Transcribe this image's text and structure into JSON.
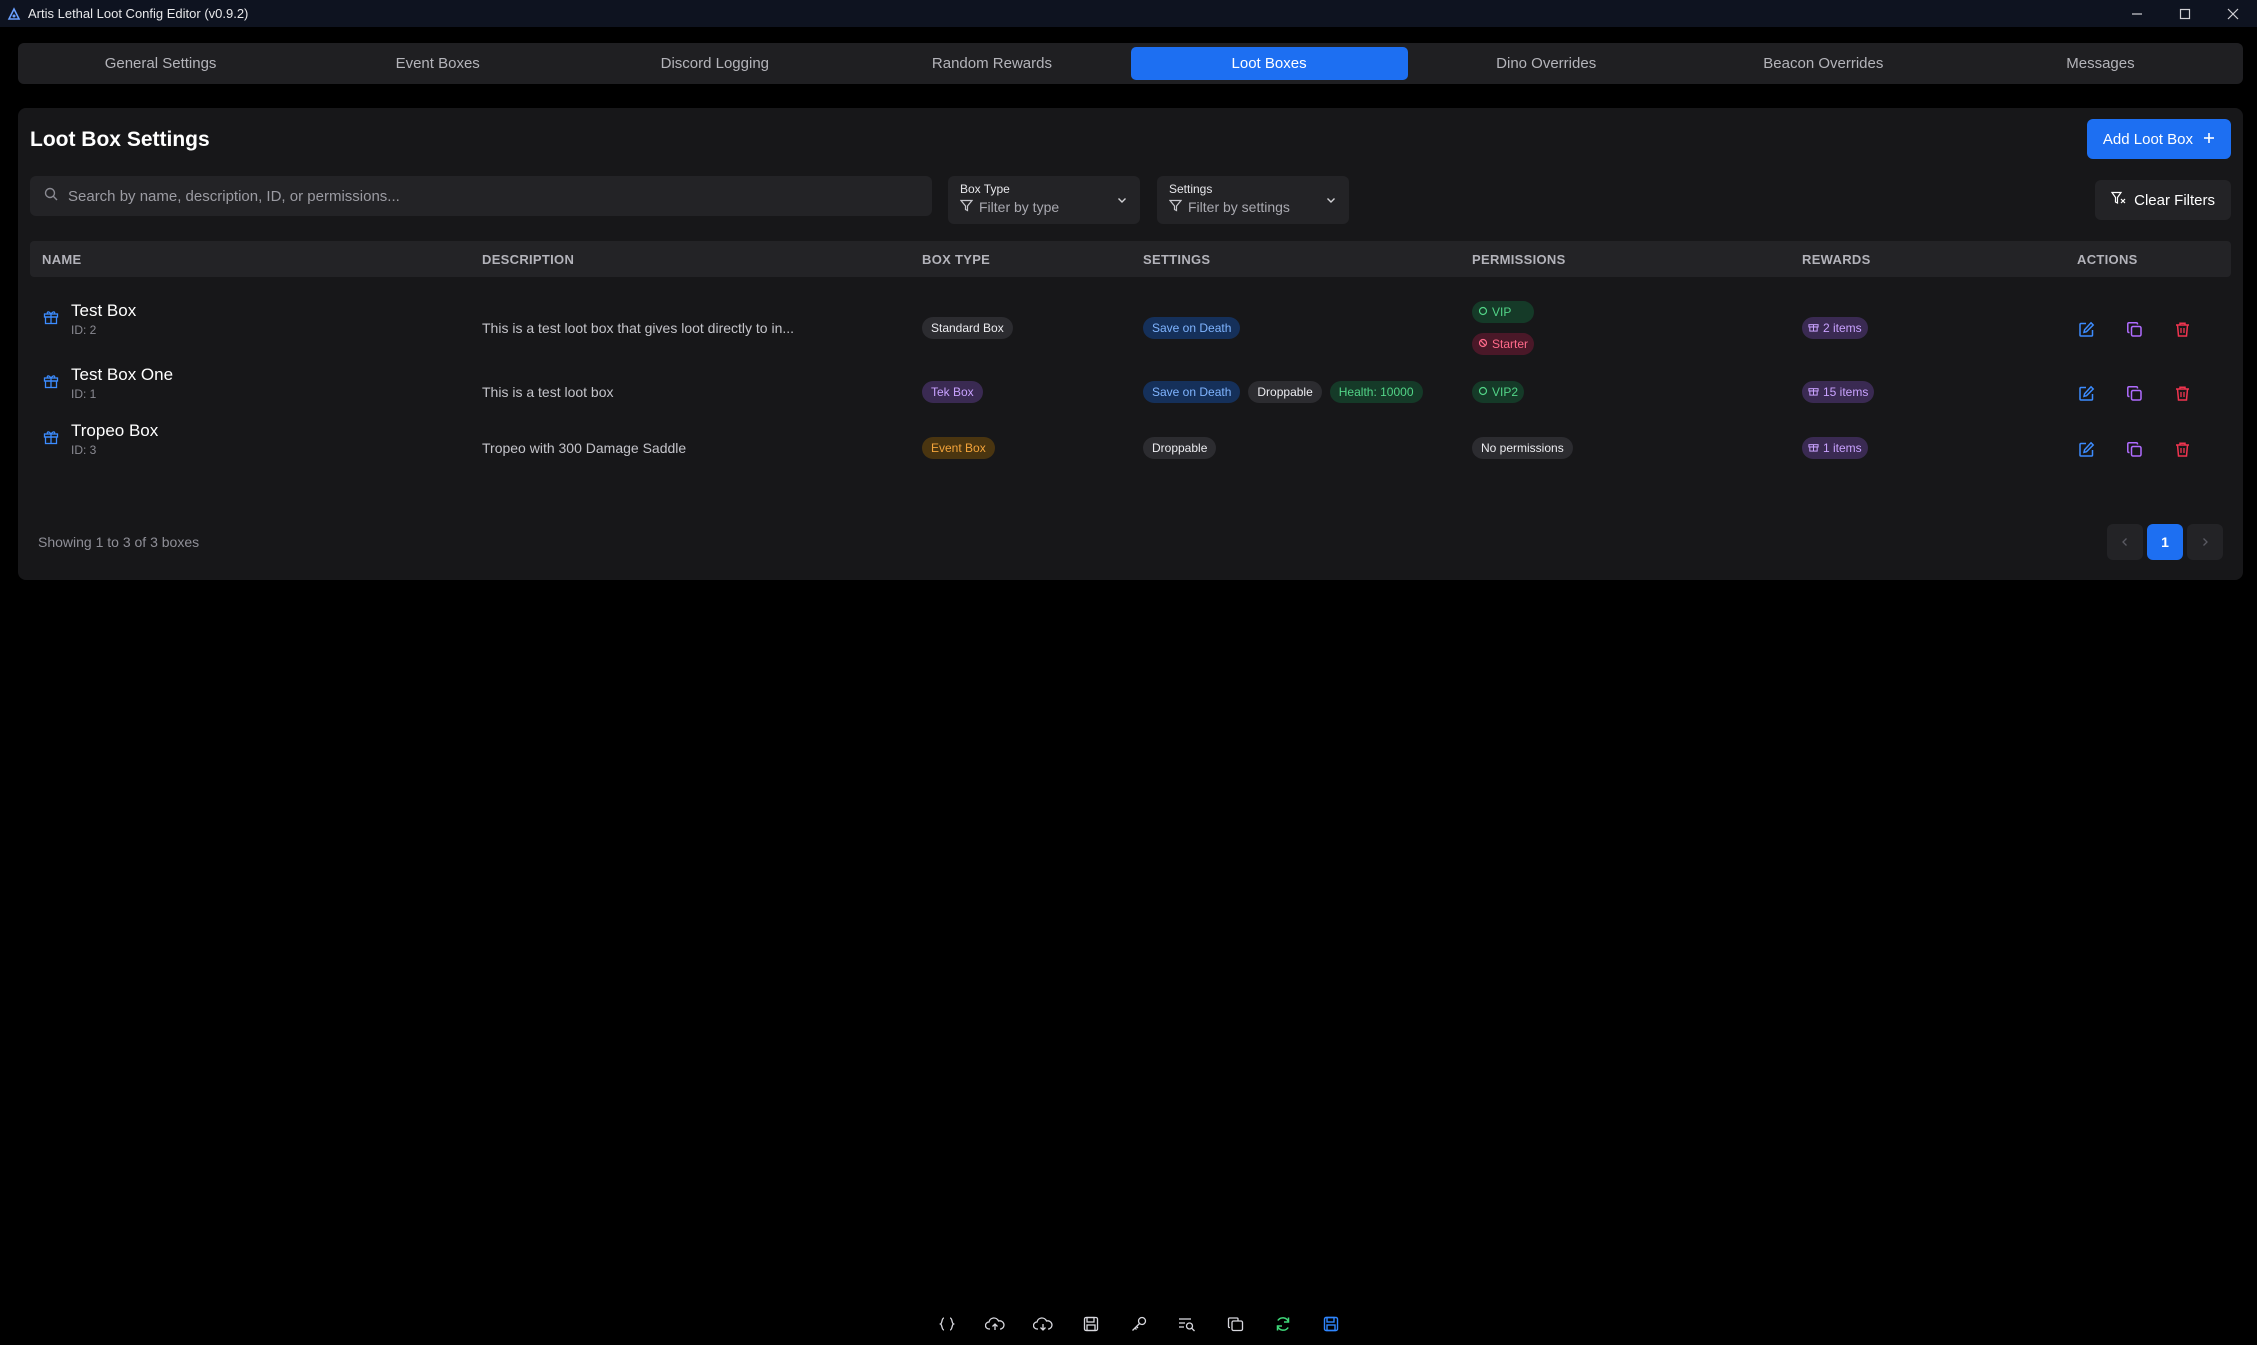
{
  "window": {
    "title": "Artis Lethal Loot Config Editor (v0.9.2)"
  },
  "tabs": [
    {
      "label": "General Settings"
    },
    {
      "label": "Event Boxes"
    },
    {
      "label": "Discord Logging"
    },
    {
      "label": "Random Rewards"
    },
    {
      "label": "Loot Boxes",
      "active": true
    },
    {
      "label": "Dino Overrides"
    },
    {
      "label": "Beacon Overrides"
    },
    {
      "label": "Messages"
    }
  ],
  "panel": {
    "title": "Loot Box Settings",
    "add_button": "Add Loot Box",
    "search_placeholder": "Search by name, description, ID, or permissions...",
    "box_type_filter": {
      "label": "Box Type",
      "value": "Filter by type"
    },
    "settings_filter": {
      "label": "Settings",
      "value": "Filter by settings"
    },
    "clear_filters": "Clear Filters"
  },
  "table": {
    "headers": {
      "name": "NAME",
      "description": "DESCRIPTION",
      "box_type": "BOX TYPE",
      "settings": "SETTINGS",
      "permissions": "PERMISSIONS",
      "rewards": "REWARDS",
      "actions": "ACTIONS"
    },
    "rows": [
      {
        "name": "Test Box",
        "id": "ID: 2",
        "description": "This is a test loot box that gives loot directly to in...",
        "box_type": "Standard Box",
        "settings": [
          "Save on Death"
        ],
        "permissions": [
          "VIP",
          "Starter"
        ],
        "rewards": "2 items"
      },
      {
        "name": "Test Box One",
        "id": "ID: 1",
        "description": "This is a test loot box",
        "box_type": "Tek Box",
        "settings": [
          "Save on Death",
          "Droppable",
          "Health: 10000"
        ],
        "permissions": [
          "VIP2"
        ],
        "rewards": "15 items"
      },
      {
        "name": "Tropeo Box",
        "id": "ID: 3",
        "description": "Tropeo with 300 Damage Saddle",
        "box_type": "Event Box",
        "settings": [
          "Droppable"
        ],
        "permissions": [
          "No permissions"
        ],
        "rewards": "1 items"
      }
    ]
  },
  "footer": {
    "showing": "Showing 1 to 3 of 3 boxes",
    "page": "1"
  },
  "colors": {
    "accent": "#1d6ff2",
    "background": "#000000",
    "panel": "#171719"
  }
}
